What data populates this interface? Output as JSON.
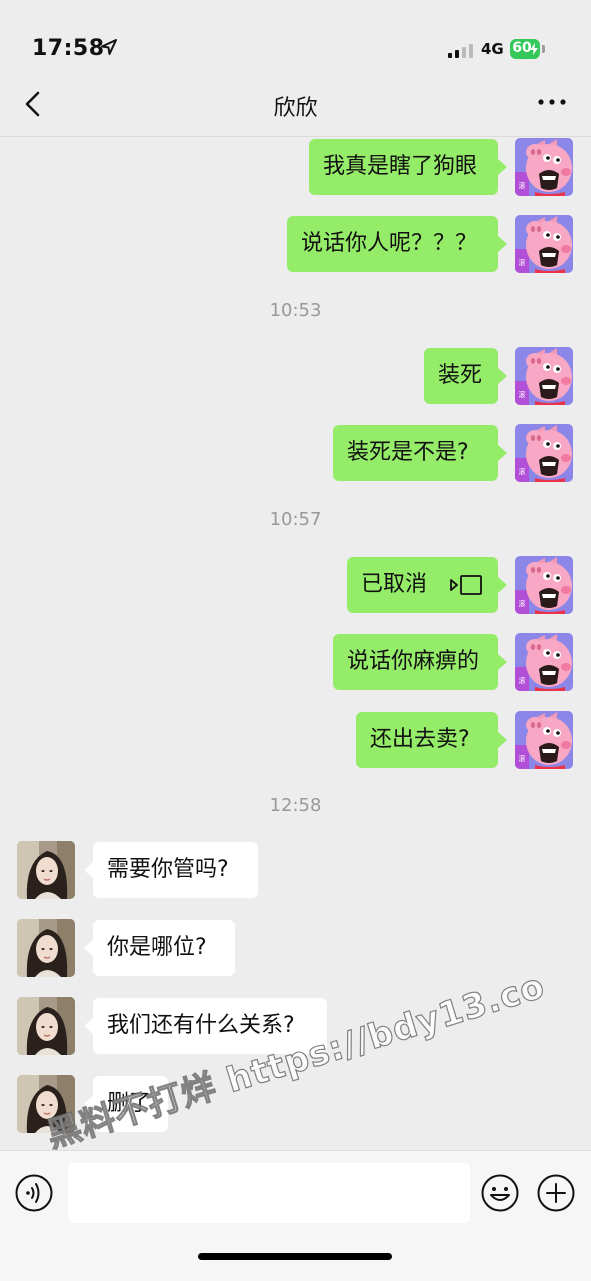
{
  "status_bar": {
    "time": "17:58",
    "network": "4G",
    "battery": "60"
  },
  "header": {
    "title": "欣欣"
  },
  "messages": [
    {
      "side": "out",
      "text": "我真是瞎了狗眼"
    },
    {
      "side": "out",
      "text": "说话你人呢？？？"
    },
    {
      "timestamp": "10:53"
    },
    {
      "side": "out",
      "text": "装死"
    },
    {
      "side": "out",
      "text": "装死是不是?"
    },
    {
      "timestamp": "10:57"
    },
    {
      "side": "out",
      "text": "已取消",
      "icon": "call-cancelled-icon"
    },
    {
      "side": "out",
      "text": "说话你麻痹的"
    },
    {
      "side": "out",
      "text": "还出去卖?"
    },
    {
      "timestamp": "12:58"
    },
    {
      "side": "in",
      "text": "需要你管吗?"
    },
    {
      "side": "in",
      "text": "你是哪位?"
    },
    {
      "side": "in",
      "text": "我们还有什么关系?"
    },
    {
      "side": "in",
      "text": "删了"
    }
  ],
  "watermark": "黑料不打烊 https://bdy13.co",
  "input": {
    "value": "",
    "placeholder": ""
  },
  "colors": {
    "outgoing_bubble": "#95ec69",
    "incoming_bubble": "#ffffff",
    "background": "#ededed"
  }
}
